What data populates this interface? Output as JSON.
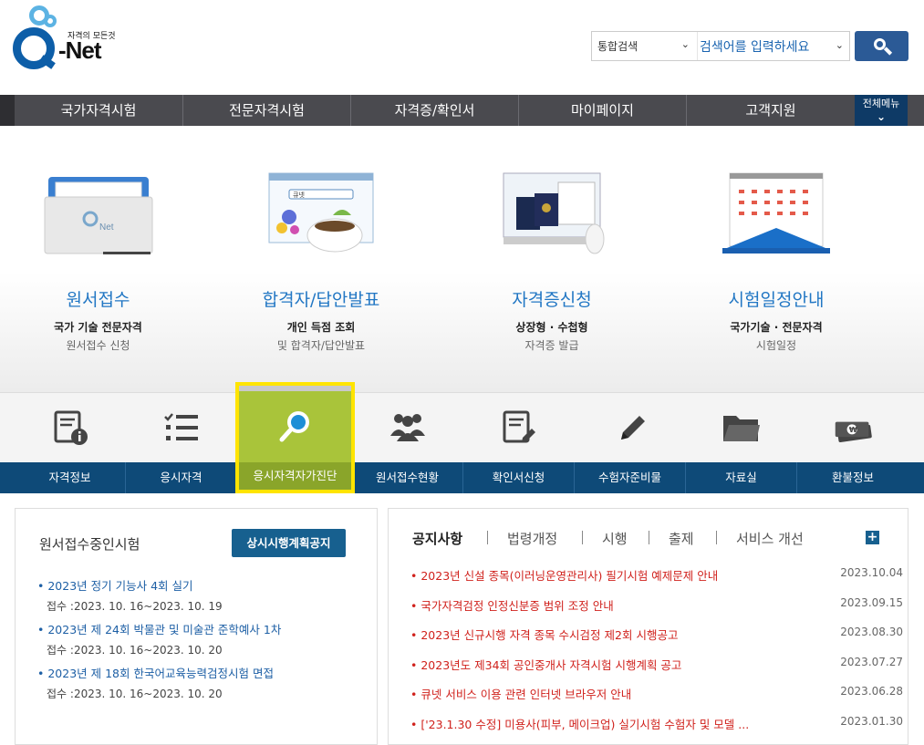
{
  "header": {
    "logo_tagline": "자격의 모든것",
    "logo_text": "-Net",
    "search_scope": "통합검색",
    "search_placeholder": "검색어를 입력하세요"
  },
  "gnb": {
    "items": [
      "국가자격시험",
      "전문자격시험",
      "자격증/확인서",
      "마이페이지",
      "고객지원"
    ],
    "all_menu": "전체메뉴"
  },
  "hero": [
    {
      "title": "원서접수",
      "sub1": "국가 기술 전문자격",
      "sub2": "원서접수 신청"
    },
    {
      "title": "합격자/답안발표",
      "sub1": "개인 득점 조회",
      "sub2": "및 합격자/답안발표"
    },
    {
      "title": "자격증신청",
      "sub1": "상장형 · 수첩형",
      "sub2": "자격증 발급"
    },
    {
      "title": "시험일정안내",
      "sub1": "국가기술 · 전문자격",
      "sub2": "시험일정"
    }
  ],
  "quick": [
    {
      "label": "자격정보",
      "icon": "document-info-icon"
    },
    {
      "label": "응시자격",
      "icon": "checklist-icon"
    },
    {
      "label": "응시자격자가진단",
      "icon": "magnifier-icon"
    },
    {
      "label": "원서접수현황",
      "icon": "people-icon"
    },
    {
      "label": "확인서신청",
      "icon": "certificate-edit-icon"
    },
    {
      "label": "수험자준비물",
      "icon": "pencil-icon"
    },
    {
      "label": "자료실",
      "icon": "folder-icon"
    },
    {
      "label": "환불정보",
      "icon": "money-icon"
    }
  ],
  "exams": {
    "heading": "원서접수중인시험",
    "plan_button": "상시시행계획공지",
    "items": [
      {
        "title": "• 2023년 정기 기능사 4회 실기",
        "date": "접수 :2023. 10. 16~2023. 10. 19"
      },
      {
        "title": "• 2023년 제 24회 박물관 및 미술관 준학예사 1차",
        "date": "접수 :2023. 10. 16~2023. 10. 20"
      },
      {
        "title": "• 2023년 제 18회 한국어교육능력검정시험 면접",
        "date": "접수 :2023. 10. 16~2023. 10. 20"
      }
    ]
  },
  "notice": {
    "tabs": [
      "공지사항",
      "법령개정",
      "시행",
      "출제",
      "서비스 개선"
    ],
    "more": "+",
    "items": [
      {
        "title": "• 2023년 신설 종목(이러닝운영관리사) 필기시험 예제문제 안내",
        "date": "2023.10.04"
      },
      {
        "title": "• 국가자격검정 인정신분증 범위 조정 안내",
        "date": "2023.09.15"
      },
      {
        "title": "• 2023년 신규시행 자격 종목 수시검정 제2회 시행공고",
        "date": "2023.08.30"
      },
      {
        "title": "• 2023년도 제34회 공인중개사 자격시험 시행계획 공고",
        "date": "2023.07.27"
      },
      {
        "title": "• 큐넷 서비스 이용 관련 인터넷 브라우저 안내",
        "date": "2023.06.28"
      },
      {
        "title": "• ['23.1.30 수정] 미용사(피부, 메이크업) 실기시험 수험자 및 모델 ...",
        "date": "2023.01.30"
      }
    ]
  }
}
